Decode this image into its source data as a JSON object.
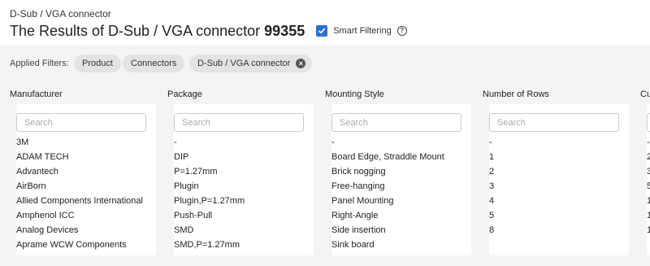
{
  "header": {
    "breadcrumb": "D-Sub / VGA connector",
    "title_prefix": "The Results of D-Sub / VGA connector",
    "result_count": "99355",
    "smart_filtering": {
      "label": "Smart Filtering",
      "checked": true
    }
  },
  "applied_filters": {
    "label": "Applied Filters:",
    "chips": [
      "Product",
      "Connectors",
      "D-Sub / VGA connector"
    ]
  },
  "colors": {
    "accent": "#2b6fd6",
    "band": "#f4f4f5",
    "chip": "#e3e3e5"
  },
  "facets": [
    {
      "title": "Manufacturer",
      "search_placeholder": "Search",
      "items": [
        "3M",
        "ADAM TECH",
        "Advantech",
        "AirBorn",
        "Allied Components International",
        "Amphenol ICC",
        "Analog Devices",
        "Aprame WCW Components"
      ]
    },
    {
      "title": "Package",
      "search_placeholder": "Search",
      "items": [
        "-",
        "DIP",
        "P=1.27mm",
        "Plugin",
        "Plugin,P=1.27mm",
        "Push-Pull",
        "SMD",
        "SMD,P=1.27mm"
      ]
    },
    {
      "title": "Mounting Style",
      "search_placeholder": "Search",
      "items": [
        "-",
        "Board Edge, Straddle Mount",
        "Brick nogging",
        "Free-hanging",
        "Panel Mounting",
        "Right-Angle",
        "Side insertion",
        "Sink board"
      ]
    },
    {
      "title": "Number of Rows",
      "search_placeholder": "Search",
      "items": [
        "-",
        "1",
        "2",
        "3",
        "4",
        "5",
        "8"
      ]
    },
    {
      "title": "Cu",
      "search_placeholder": "Search",
      "items": [
        "-",
        "2",
        "3",
        "5",
        "1",
        "1",
        "1"
      ]
    }
  ]
}
